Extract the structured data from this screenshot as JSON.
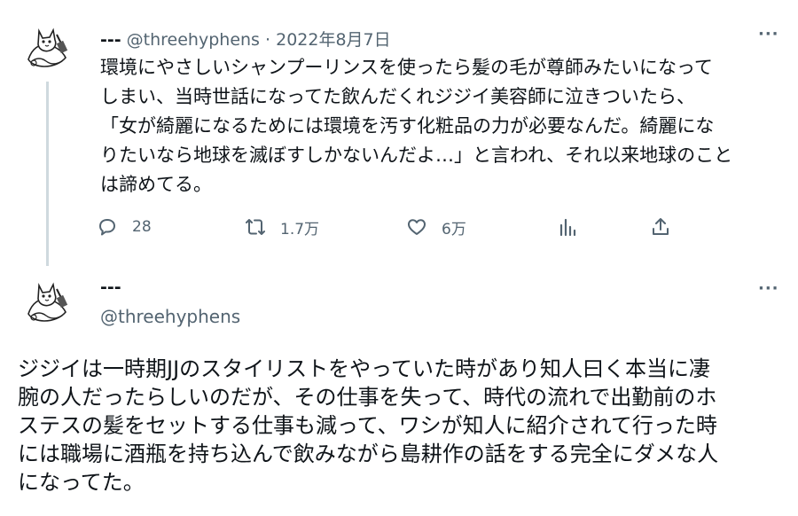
{
  "tweet1": {
    "display_name": "---",
    "handle": "@threehyphens",
    "separator": "·",
    "date": "2022年8月7日",
    "more": "···",
    "text_lines": [
      "環境にやさしいシャンプーリンスを使ったら髪の毛が尊師みたいになって",
      "しまい、当時世話になってた飲んだくれジジイ美容師に泣きついたら、",
      "「女が綺麗になるためには環境を汚す化粧品の力が必要なんだ。綺麗にな",
      "りたいなら地球を滅ぼすしかないんだよ…」と言われ、それ以来地球のこと",
      "は諦めてる。"
    ],
    "actions": {
      "reply_icon": "reply-icon",
      "reply_count": "28",
      "retweet_icon": "retweet-icon",
      "retweet_count": "1.7万",
      "like_icon": "heart-icon",
      "like_count": "6万",
      "analytics_icon": "bar-chart-icon",
      "share_icon": "share-icon"
    }
  },
  "tweet2": {
    "display_name": "---",
    "handle": "@threehyphens",
    "more": "···",
    "text_lines": [
      "ジジイは一時期JJのスタイリストをやっていた時があり知人曰く本当に凄",
      "腕の人だったらしいのだが、その仕事を失って、時代の流れで出勤前のホ",
      "ステスの髪をセットする仕事も減って、ワシが知人に紹介されて行った時",
      "には職場に酒瓶を持ち込んで飲みながら島耕作の話をする完全にダメな人",
      "になってた。"
    ]
  },
  "colors": {
    "text": "#0f1419",
    "secondary": "#536471",
    "thread_line": "#cfd9de"
  }
}
